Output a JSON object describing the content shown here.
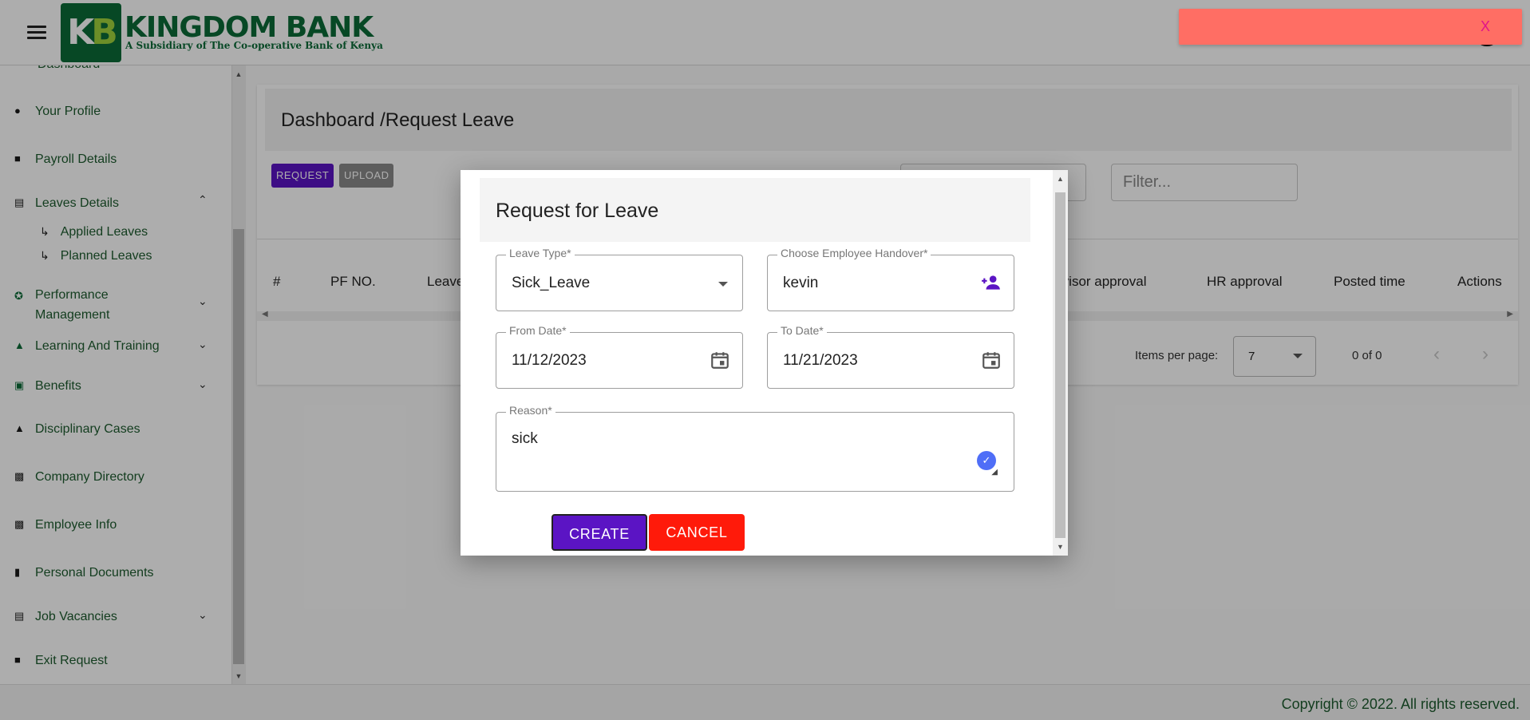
{
  "header": {
    "logo_initials": "KB",
    "logo_name": "KINGDOM BANK",
    "logo_subtitle": "A Subsidiary of The Co-operative Bank of Kenya"
  },
  "sidebar": {
    "items": [
      {
        "label": "Dashboard",
        "icon": "dashboard-icon"
      },
      {
        "label": "Your Profile",
        "icon": "person-icon"
      },
      {
        "label": "Payroll Details",
        "icon": "clipboard-money-icon"
      },
      {
        "label": "Leaves Details",
        "icon": "calendar-icon",
        "expanded": true
      },
      {
        "label": "Applied Leaves",
        "icon": "subdirectory-arrow-icon"
      },
      {
        "label": "Planned Leaves",
        "icon": "subdirectory-arrow-icon"
      },
      {
        "label": "Performance Management",
        "icon": "award-icon"
      },
      {
        "label": "Learning And Training",
        "icon": "school-icon"
      },
      {
        "label": "Benefits",
        "icon": "chair-icon"
      },
      {
        "label": "Disciplinary Cases",
        "icon": "warning-icon"
      },
      {
        "label": "Company Directory",
        "icon": "contacts-icon"
      },
      {
        "label": "Employee Info",
        "icon": "badge-icon"
      },
      {
        "label": "Personal Documents",
        "icon": "document-icon"
      },
      {
        "label": "Job Vacancies",
        "icon": "calendar-icon"
      },
      {
        "label": "Exit Request",
        "icon": "clipboard-icon"
      }
    ]
  },
  "page": {
    "breadcrumb_title": "Dashboard /Request Leave",
    "request_label": "REQUEST",
    "upload_label": "UPLOAD",
    "filter_placeholder": "Filter...",
    "table_headers": [
      "#",
      "PF NO.",
      "Leave",
      "rvisor approval",
      "HR approval",
      "Posted time",
      "Actions"
    ],
    "items_per_page_label": "Items per page:",
    "items_per_page_value": "7",
    "range_label": "0 of 0"
  },
  "toast": {
    "close_label": "X",
    "color": "#ff6e64"
  },
  "dialog": {
    "title": "Request for Leave",
    "leave_type": {
      "label": "Leave Type*",
      "value": "Sick_Leave"
    },
    "handover": {
      "label": "Choose Employee Handover*",
      "value": "kevin"
    },
    "from_date": {
      "label": "From Date*",
      "value": "11/12/2023"
    },
    "to_date": {
      "label": "To Date*",
      "value": "11/21/2023"
    },
    "reason": {
      "label": "Reason*",
      "value": "sick"
    },
    "create_label": "CREATE",
    "cancel_label": "CANCEL"
  },
  "footer": {
    "copyright": "Copyright © 2022. All rights reserved."
  },
  "colors": {
    "brand_green": "#0b6b37",
    "accent_purple": "#5b14c4",
    "cancel_red": "#ff1a0a"
  }
}
